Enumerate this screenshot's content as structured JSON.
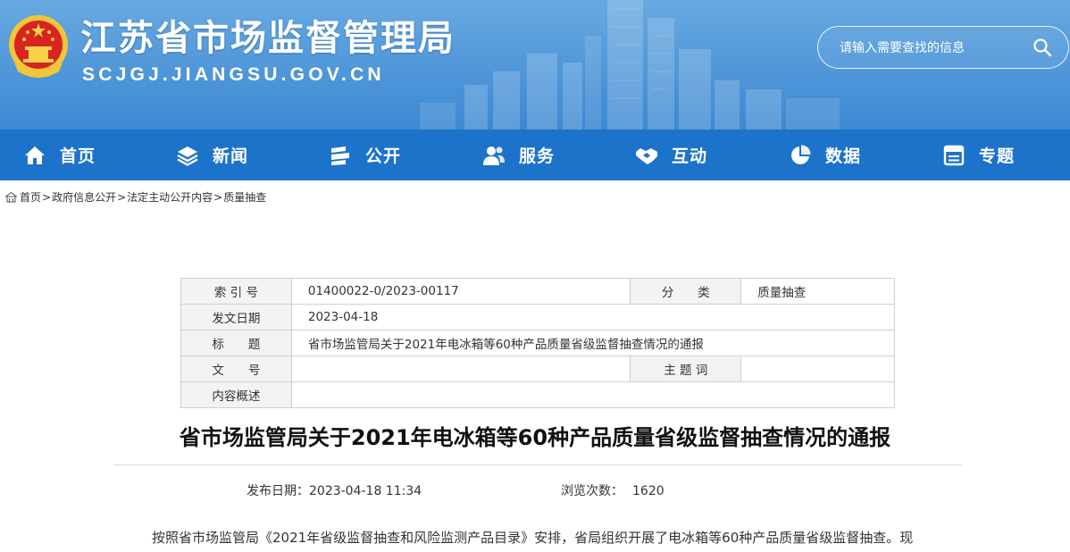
{
  "header": {
    "site_title": "江苏省市场监督管理局",
    "site_domain": "SCJGJ.JIANGSU.GOV.CN",
    "search_placeholder": "请输入需要查找的信息",
    "bg_color": "#4a92d8"
  },
  "nav": {
    "bg_color": "#1d73c9",
    "items": [
      {
        "label": "首页",
        "icon": "home-icon"
      },
      {
        "label": "新闻",
        "icon": "layers-icon"
      },
      {
        "label": "公开",
        "icon": "stack-icon"
      },
      {
        "label": "服务",
        "icon": "users-icon"
      },
      {
        "label": "互动",
        "icon": "handshake-icon"
      },
      {
        "label": "数据",
        "icon": "pie-chart-icon"
      },
      {
        "label": "专题",
        "icon": "window-icon"
      }
    ]
  },
  "breadcrumb": [
    "首页",
    "政府信息公开",
    "法定主动公开内容",
    "质量抽查"
  ],
  "meta": {
    "index_label": "索 引 号",
    "index_value": "01400022-0/2023-00117",
    "category_label": "分　　类",
    "category_value": "质量抽查",
    "date_label": "发文日期",
    "date_value": "2023-04-18",
    "title_label": "标　　题",
    "title_value": "省市场监管局关于2021年电冰箱等60种产品质量省级监督抽查情况的通报",
    "docno_label": "文　　号",
    "docno_value": "",
    "subject_label": "主 题 词",
    "subject_value": "",
    "summary_label": "内容概述",
    "summary_value": ""
  },
  "article": {
    "title": "省市场监管局关于2021年电冰箱等60种产品质量省级监督抽查情况的通报",
    "publish_label": "发布日期：",
    "publish_value": "2023-04-18 11:34",
    "views_label": "浏览次数：",
    "views_value": "1620",
    "body_first_line": "按照省市场监管局《2021年省级监督抽查和风险监测产品目录》安排，省局组织开展了电冰箱等60种产品质量省级监督抽查。现"
  }
}
